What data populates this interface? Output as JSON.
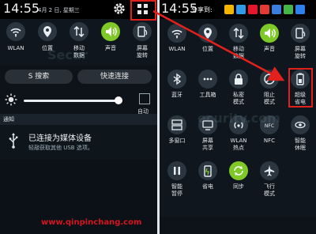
{
  "left": {
    "time": "14:55",
    "date": "4月 2 日, 星期三",
    "toggles": [
      {
        "label": "WLAN",
        "icon": "wifi-icon",
        "on": false
      },
      {
        "label": "位置",
        "icon": "location-icon",
        "on": false
      },
      {
        "label": "移动\n数据",
        "icon": "mobile-data-icon",
        "on": false
      },
      {
        "label": "声音",
        "icon": "sound-icon",
        "on": true
      },
      {
        "label": "屏幕\n旋转",
        "icon": "rotate-icon",
        "on": false
      }
    ],
    "search_label": "S 搜索",
    "quick_connect_label": "快速连接",
    "brightness": {
      "value": 0.97,
      "auto_label": "自动"
    },
    "notifications_header": "通知",
    "notification": {
      "title": "已连接为媒体设备",
      "subtitle": "轻敲获取其他 USB 选项。"
    }
  },
  "right": {
    "time": "14:55",
    "share_label": "分享到:",
    "share_icons": [
      {
        "icon": "qq-zone-icon",
        "color": "#f4b400"
      },
      {
        "icon": "tencent-weibo-icon",
        "color": "#2f9be8"
      },
      {
        "icon": "sina-weibo-icon",
        "color": "#e6162d"
      },
      {
        "icon": "renren-icon",
        "color": "#e53935"
      },
      {
        "icon": "kaixin-icon",
        "color": "#3b7ddd"
      },
      {
        "icon": "wechat-icon",
        "color": "#44b549"
      },
      {
        "icon": "more-share-icon",
        "color": "#2f80ed"
      }
    ],
    "tiles": [
      {
        "label": "WLAN",
        "icon": "wifi-icon",
        "on": false
      },
      {
        "label": "位置",
        "icon": "location-icon",
        "on": false
      },
      {
        "label": "移动\n数据",
        "icon": "mobile-data-icon",
        "on": false
      },
      {
        "label": "声音",
        "icon": "sound-icon",
        "on": true
      },
      {
        "label": "屏幕\n旋转",
        "icon": "rotate-icon",
        "on": false
      },
      {
        "label": "蓝牙",
        "icon": "bluetooth-icon",
        "on": false
      },
      {
        "label": "工具箱",
        "icon": "toolbox-icon",
        "on": false
      },
      {
        "label": "私密\n模式",
        "icon": "private-mode-icon",
        "on": false
      },
      {
        "label": "阻止\n模式",
        "icon": "block-mode-icon",
        "on": false
      },
      {
        "label": "超级\n省电",
        "icon": "ultra-power-saving-icon",
        "on": false
      },
      {
        "label": "多窗口",
        "icon": "multi-window-icon",
        "on": false
      },
      {
        "label": "屏幕\n共享",
        "icon": "screen-share-icon",
        "on": false
      },
      {
        "label": "WLAN\n热点",
        "icon": "hotspot-icon",
        "on": false
      },
      {
        "label": "NFC",
        "icon": "nfc-icon",
        "on": false
      },
      {
        "label": "智能\n休眠",
        "icon": "smart-stay-icon",
        "on": false
      },
      {
        "label": "智能\n暂停",
        "icon": "smart-pause-icon",
        "on": false
      },
      {
        "label": "省电",
        "icon": "power-saving-icon",
        "on": false
      },
      {
        "label": "同步",
        "icon": "sync-icon",
        "on": true
      },
      {
        "label": "飞行\n模式",
        "icon": "airplane-icon",
        "on": false
      }
    ]
  },
  "footer_url": "www.qinpinchang.com",
  "accent": "#7ec927",
  "highlight_color": "#e3211c"
}
